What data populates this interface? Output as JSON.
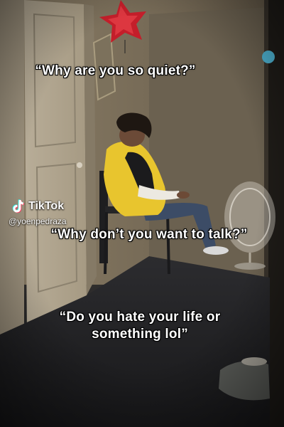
{
  "captions": {
    "line1": "“Why are you so quiet?”",
    "line2": "“Why don’t you want to talk?”",
    "line3": "“Do you hate your life or something lol”"
  },
  "watermark": {
    "brand": "TikTok",
    "handle": "@yoenpedraza",
    "icon": "tiktok-logo-icon"
  },
  "colors": {
    "caption_text": "#ffffff",
    "caption_outline": "#000000",
    "jacket_yellow": "#e8c52e",
    "balloon_red": "#c41e2a"
  }
}
